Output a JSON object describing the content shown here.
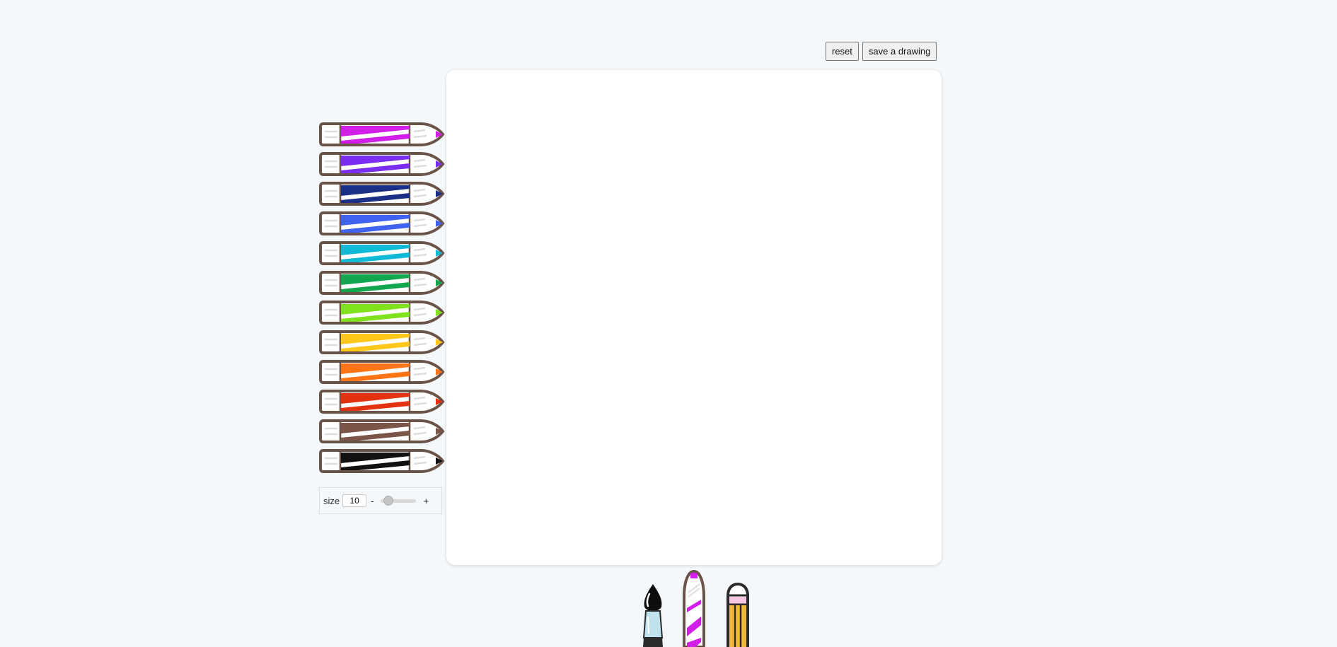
{
  "toolbar": {
    "reset_label": "reset",
    "save_label": "save a drawing"
  },
  "palette": {
    "colors": [
      {
        "name": "magenta",
        "hex": "#d11ee8"
      },
      {
        "name": "violet",
        "hex": "#7a2cf0"
      },
      {
        "name": "navy",
        "hex": "#1a2f86"
      },
      {
        "name": "blue",
        "hex": "#3f63f0"
      },
      {
        "name": "cyan",
        "hex": "#10b9d6"
      },
      {
        "name": "green",
        "hex": "#12a64e"
      },
      {
        "name": "lime",
        "hex": "#80e21c"
      },
      {
        "name": "yellow",
        "hex": "#ffc719"
      },
      {
        "name": "orange",
        "hex": "#ff7414"
      },
      {
        "name": "red",
        "hex": "#e2320f"
      },
      {
        "name": "brown",
        "hex": "#7b5548"
      },
      {
        "name": "black",
        "hex": "#111111"
      }
    ],
    "selected": "magenta"
  },
  "size": {
    "label": "size",
    "value": "10",
    "minus": "-",
    "plus": "+",
    "level": 0.1
  },
  "tools": {
    "items": [
      "brush-icon",
      "marker-icon",
      "pencil-icon"
    ],
    "active": "marker-icon"
  }
}
